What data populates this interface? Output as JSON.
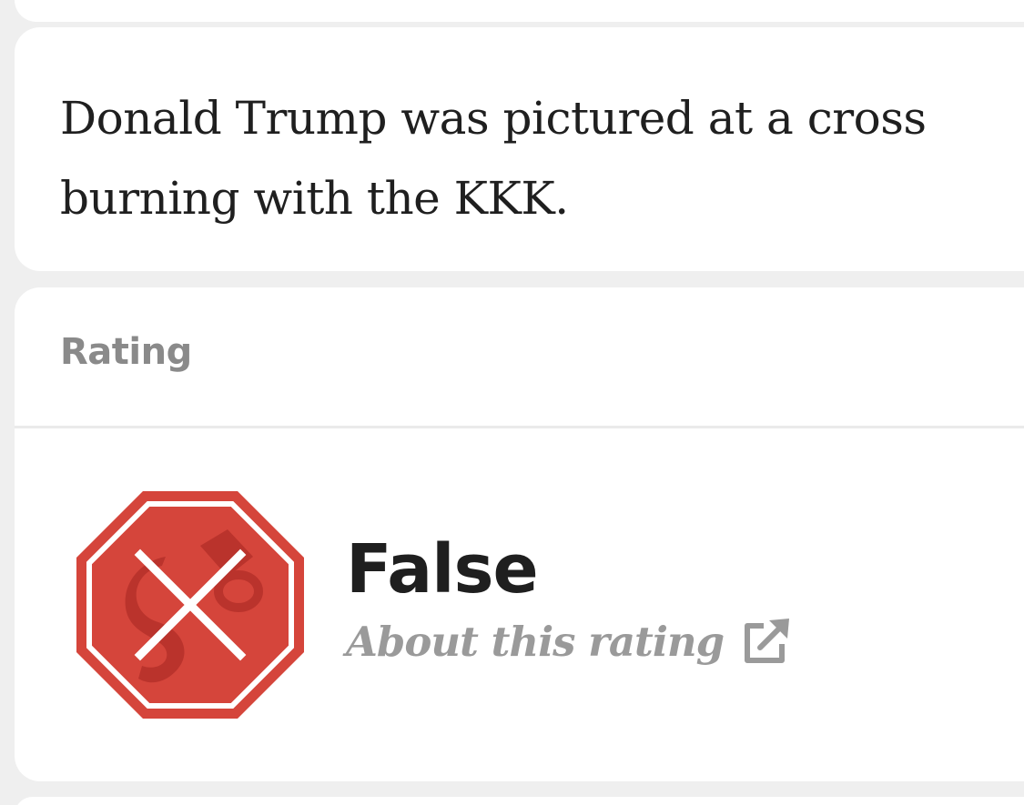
{
  "claim": {
    "text": "Donald Trump was pictured at a cross burning with the KKK."
  },
  "rating": {
    "heading": "Rating",
    "value": "False",
    "about_link_label": "About this rating",
    "icon": "stop-sign-x-icon",
    "link_icon": "external-link-icon",
    "colors": {
      "badge_red": "#d5453b",
      "badge_dark_red": "#b6302a",
      "accent_gray": "#9a9a9a"
    }
  }
}
